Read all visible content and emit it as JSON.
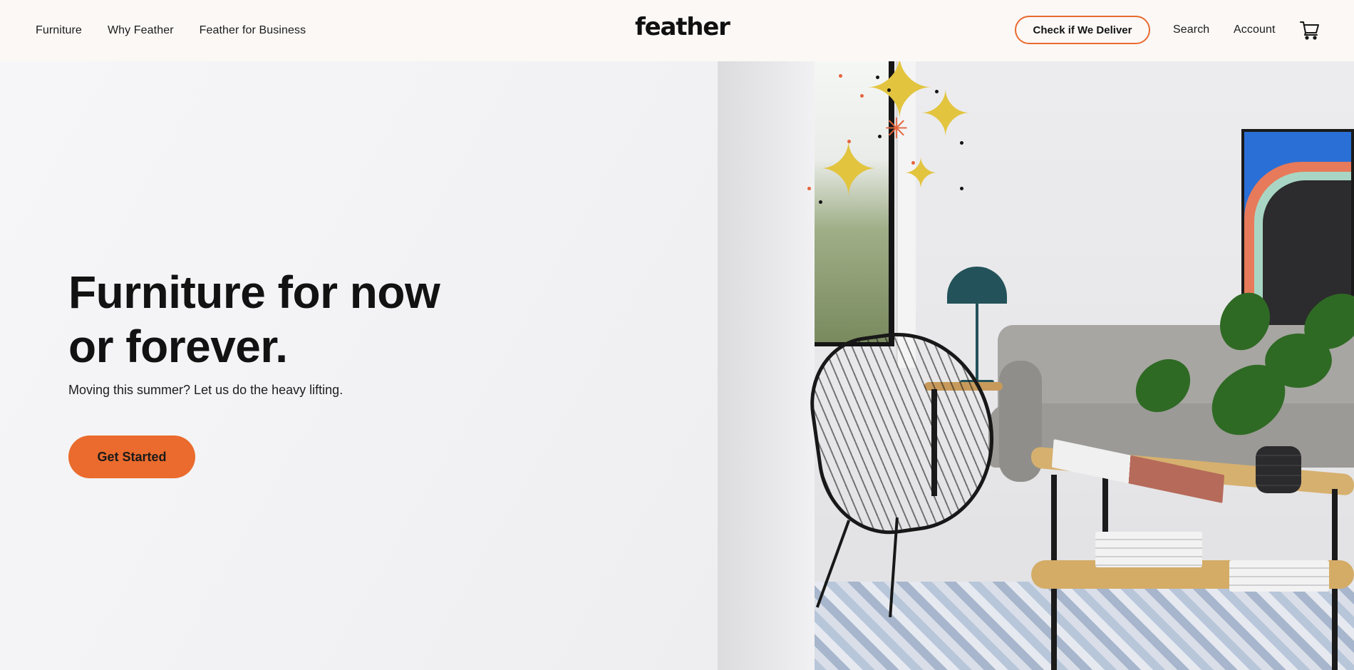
{
  "header": {
    "nav_left": [
      {
        "label": "Furniture"
      },
      {
        "label": "Why Feather"
      },
      {
        "label": "Feather for Business"
      }
    ],
    "logo": "feather",
    "deliver_button": "Check if We Deliver",
    "search": "Search",
    "account": "Account",
    "cart_icon": "cart-icon"
  },
  "hero": {
    "headline_line1": "Furniture for now",
    "headline_line2": "or forever.",
    "subline": "Moving this summer? Let us do the heavy lifting.",
    "cta": "Get Started"
  },
  "colors": {
    "accent": "#ea6b2d",
    "header_bg": "#fbf8f6",
    "text": "#121212"
  }
}
